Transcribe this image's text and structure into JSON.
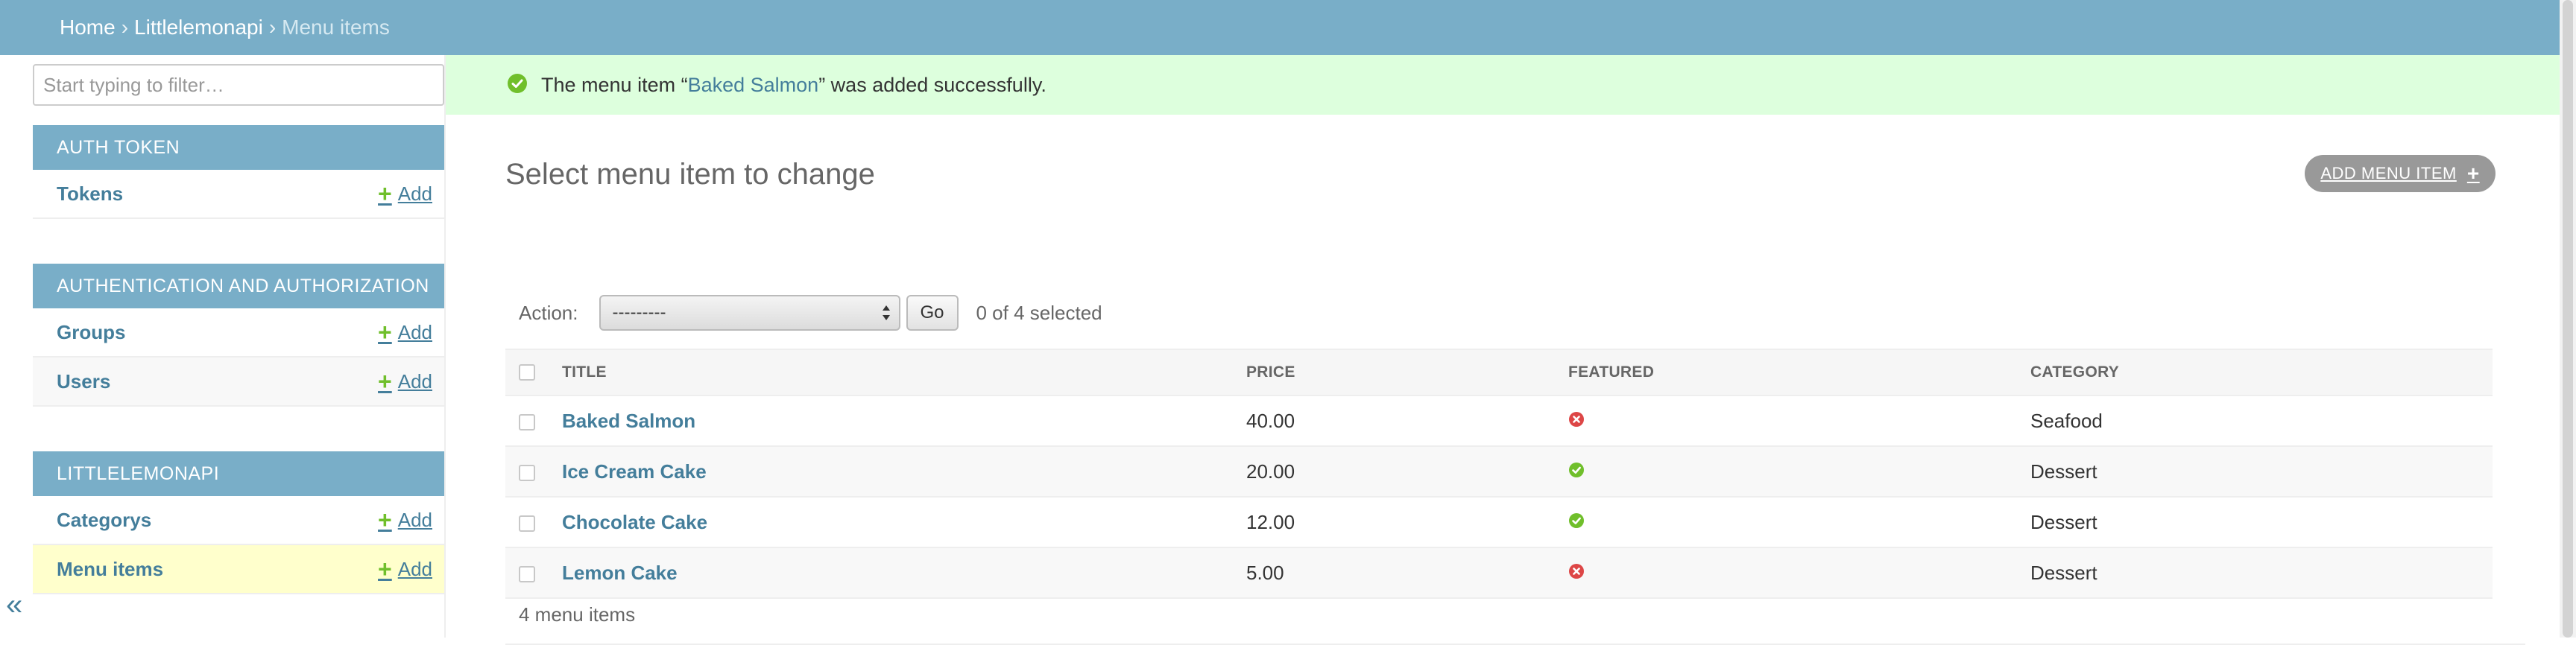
{
  "breadcrumb": {
    "items": [
      "Home",
      "Littlelemonapi",
      "Menu items"
    ],
    "separator": "›"
  },
  "sidebar": {
    "filter_placeholder": "Start typing to filter…",
    "modules": [
      {
        "caption": "AUTH TOKEN",
        "rows": [
          {
            "name": "Tokens",
            "add": "Add"
          }
        ]
      },
      {
        "caption": "AUTHENTICATION AND AUTHORIZATION",
        "rows": [
          {
            "name": "Groups",
            "add": "Add"
          },
          {
            "name": "Users",
            "add": "Add"
          }
        ]
      },
      {
        "caption": "LITTLELEMONAPI",
        "rows": [
          {
            "name": "Categorys",
            "add": "Add"
          },
          {
            "name": "Menu items",
            "add": "Add",
            "selected": true
          }
        ]
      }
    ],
    "collapse_glyph": "«"
  },
  "messages": {
    "success_prefix": "The menu item “",
    "success_link": "Baked Salmon",
    "success_suffix": "” was added successfully."
  },
  "page": {
    "title": "Select menu item to change",
    "add_button": "ADD MENU ITEM"
  },
  "actions": {
    "label": "Action:",
    "selected_option": "---------",
    "go": "Go",
    "selection_count": "0 of 4 selected"
  },
  "table": {
    "columns": [
      "TITLE",
      "PRICE",
      "FEATURED",
      "CATEGORY"
    ],
    "rows": [
      {
        "title": "Baked Salmon",
        "price": "40.00",
        "featured": false,
        "category": "Seafood"
      },
      {
        "title": "Ice Cream Cake",
        "price": "20.00",
        "featured": true,
        "category": "Dessert"
      },
      {
        "title": "Chocolate Cake",
        "price": "12.00",
        "featured": true,
        "category": "Dessert"
      },
      {
        "title": "Lemon Cake",
        "price": "5.00",
        "featured": false,
        "category": "Dessert"
      }
    ]
  },
  "paginator": {
    "text": "4 menu items"
  },
  "colors": {
    "header_bg": "#79aec8",
    "link": "#447e9b",
    "success_bg": "#ddffdd",
    "yes_icon": "#70bf2b",
    "no_icon": "#dd4646",
    "selected_row": "#ffffcc"
  },
  "icons": {
    "success": "check-circle-icon",
    "featured_yes": "yes-icon",
    "featured_no": "no-icon",
    "add": "plus-icon",
    "select_arrows": "select-arrows-icon"
  }
}
